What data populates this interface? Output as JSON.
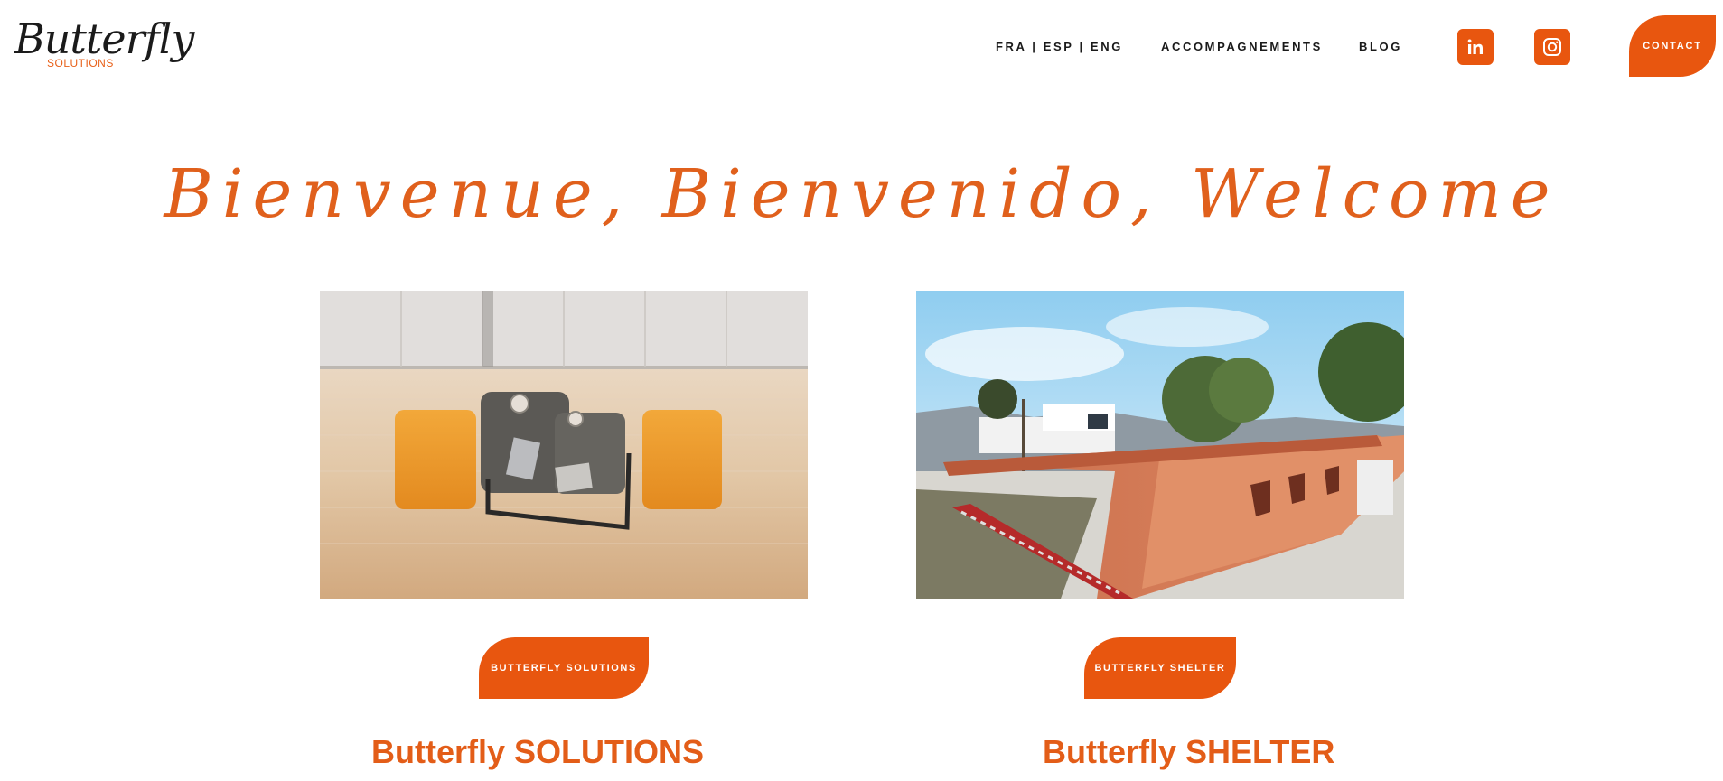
{
  "brand": {
    "logo_word": "Butterfly",
    "logo_sub": "SOLUTIONS",
    "accent_color": "#e8560f"
  },
  "nav": {
    "languages": "FRA | ESP | ENG",
    "accompagnements": "ACCOMPAGNEMENTS",
    "blog": "BLOG",
    "contact": "CONTACT"
  },
  "social": {
    "linkedin_icon": "linkedin-icon",
    "instagram_icon": "instagram-icon"
  },
  "hero": {
    "welcome": "Bienvenue, Bienvenido, Welcome"
  },
  "cards": [
    {
      "button": "BUTTERFLY SOLUTIONS",
      "title": "Butterfly SOLUTIONS",
      "image": "office-lounge-orange-stools-photo"
    },
    {
      "button": "BUTTERFLY SHELTER",
      "title": "Butterfly SHELTER",
      "image": "terracotta-house-exterior-photo"
    }
  ]
}
